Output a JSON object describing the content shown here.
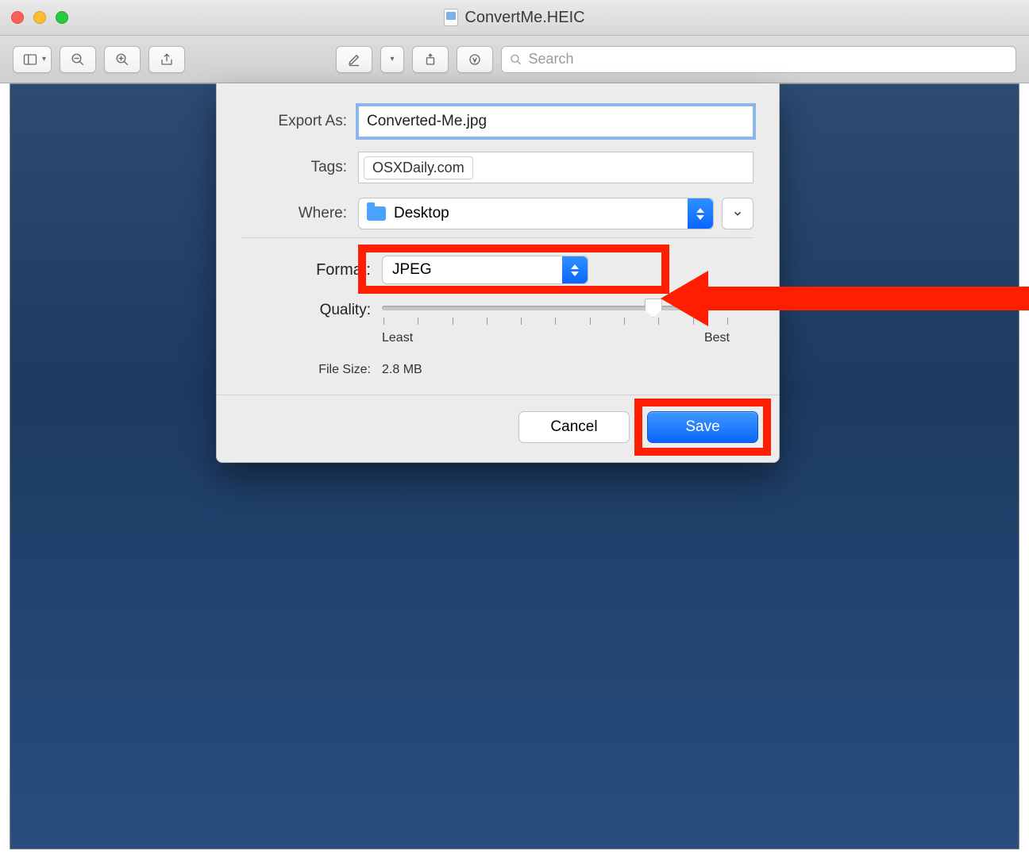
{
  "window": {
    "title": "ConvertMe.HEIC"
  },
  "toolbar": {
    "search_placeholder": "Search"
  },
  "export": {
    "export_as_label": "Export As:",
    "export_as_value": "Converted-Me.jpg",
    "tags_label": "Tags:",
    "tag_value": "OSXDaily.com",
    "where_label": "Where:",
    "where_value": "Desktop",
    "format_label": "Format:",
    "format_value": "JPEG",
    "quality_label": "Quality:",
    "quality_least": "Least",
    "quality_best": "Best",
    "file_size_label": "File Size:",
    "file_size_value": "2.8 MB",
    "cancel": "Cancel",
    "save": "Save"
  }
}
